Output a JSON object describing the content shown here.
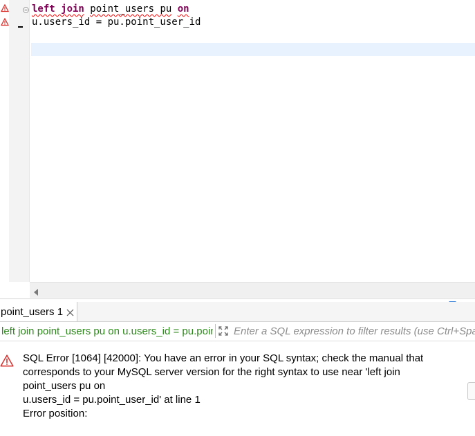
{
  "editor": {
    "line1": {
      "kw1": "left join",
      "sp1": " ",
      "ident": "point_users pu",
      "sp2": " ",
      "kw2": "on"
    },
    "line2": "u.users_id = pu.point_user_id",
    "gutter_markers": [
      "warning-icon",
      "warning-icon"
    ]
  },
  "results": {
    "tab_label": "point_users 1",
    "filter_query": "left join point_users pu on u.users_id = pu.point_user_id",
    "filter_placeholder": "Enter a SQL expression to filter results (use Ctrl+Space)"
  },
  "error": {
    "lines": [
      "SQL Error [1064] [42000]: You have an error in your SQL syntax; check the manual that",
      "corresponds to your MySQL server version for the right syntax to use near 'left join",
      "point_users pu on",
      "u.users_id = pu.point_user_id' at line 1",
      "Error position:"
    ]
  },
  "colors": {
    "keyword": "#7f0055",
    "error_underline": "#ff0000",
    "filter_text": "#2c8a1a",
    "current_line": "#e8f2fe",
    "warning": "#d9302c"
  }
}
